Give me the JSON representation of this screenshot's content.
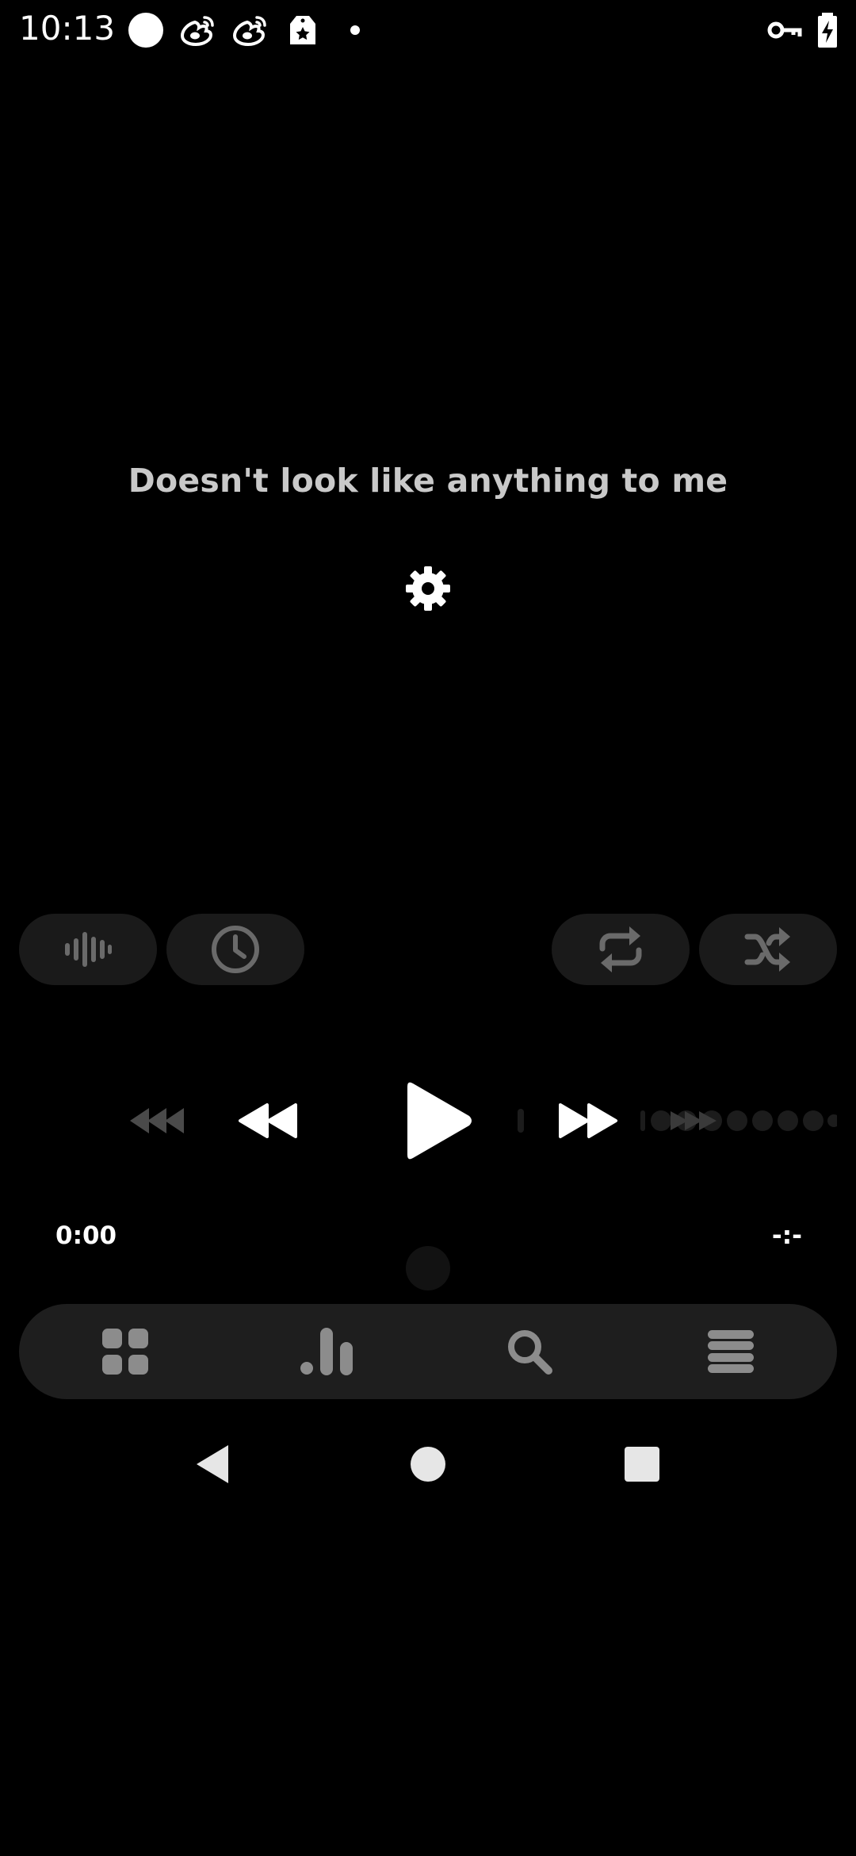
{
  "status_bar": {
    "time": "10:13",
    "icons": [
      "circle-notification-icon",
      "weibo-icon",
      "weibo-icon",
      "shopping-tag-icon",
      "dot-icon",
      "vpn-key-icon",
      "battery-charging-icon"
    ]
  },
  "empty_state": {
    "message": "Doesn't look like anything to me",
    "settings_icon": "gear-icon"
  },
  "controls": {
    "left_pills": [
      "waveform-icon",
      "clock-icon"
    ],
    "right_pills": [
      "repeat-icon",
      "shuffle-icon"
    ],
    "transport": [
      "skip-back-icon",
      "rewind-icon",
      "play-icon",
      "fast-forward-icon",
      "skip-forward-icon"
    ]
  },
  "playback": {
    "elapsed": "0:00",
    "remaining": "-:-"
  },
  "bottom_nav": {
    "items": [
      "grid-icon",
      "bar-chart-icon",
      "search-icon",
      "menu-icon"
    ]
  },
  "system_nav": {
    "items": [
      "back-icon",
      "home-icon",
      "recents-icon"
    ]
  },
  "colors": {
    "background": "#000000",
    "pill": "#1a1a1a",
    "nav_bar": "#1e1e1e",
    "muted_icon": "#5e5e5e",
    "message_text": "#c9c9c9"
  }
}
